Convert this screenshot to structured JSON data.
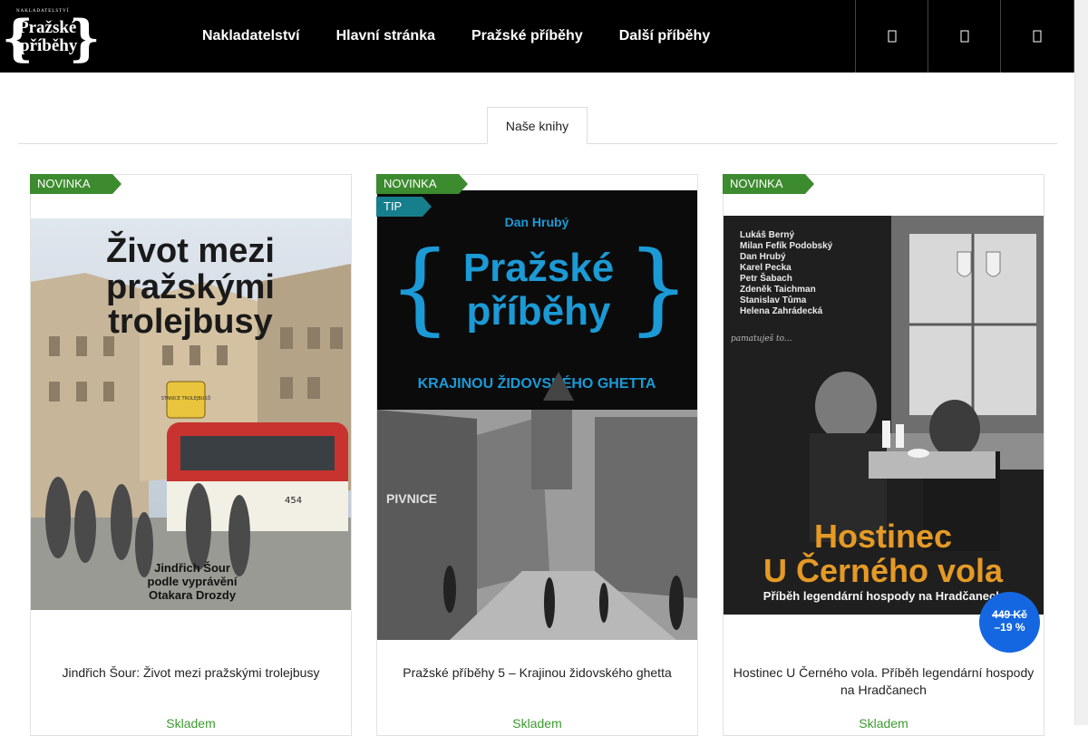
{
  "logo": {
    "small": "NAKLADATELSTVÍ",
    "line1": "Pražské",
    "line2": "příběhy",
    "brace_left": "{",
    "brace_right": "}"
  },
  "nav": [
    {
      "label": "Nakladatelství"
    },
    {
      "label": "Hlavní stránka"
    },
    {
      "label": "Pražské příběhy"
    },
    {
      "label": "Další příběhy"
    }
  ],
  "header_icons": [
    "search-icon",
    "user-icon",
    "cart-icon"
  ],
  "tabs": {
    "active": "Naše knihy"
  },
  "products": [
    {
      "flags": [
        "NOVINKA"
      ],
      "name": "Jindřich Šour: Život mezi pražskými trolejbusy",
      "stock": "Skladem",
      "cover": {
        "title1": "Život mezi",
        "title2": "pražskými",
        "title3": "trolejbusy",
        "bus_number": "454",
        "author1": "Jindřich Šour",
        "author2": "podle vyprávění",
        "author3": "Otakara Drozdy",
        "sign": "STANICE TROLEJBUSŮ"
      }
    },
    {
      "flags": [
        "NOVINKA",
        "TIP"
      ],
      "name": "Pražské příběhy 5 – Krajinou židovského ghetta",
      "stock": "Skladem",
      "cover": {
        "author": "Dan Hrubý",
        "title1": "Pražské",
        "title2": "příběhy",
        "subtitle": "KRAJINOU ŽIDOVSKÉHO GHETTA",
        "sign": "PIVNICE"
      }
    },
    {
      "flags": [
        "NOVINKA"
      ],
      "name": "Hostinec U Černého vola. Příběh legendární hospody na Hradčanech",
      "stock": "Skladem",
      "discount": {
        "old_price": "449 Kč",
        "percent": "–19 %"
      },
      "cover": {
        "authors": [
          "Lukáš Berný",
          "Milan Fefík Podobský",
          "Dan Hrubý",
          "Karel Pecka",
          "Petr Šabach",
          "Zdeněk Taichman",
          "Stanislav Tůma",
          "Helena Zahrádecká"
        ],
        "title1": "Hostinec",
        "title2": "U Černého vola",
        "subtitle": "Příběh legendární hospody na Hradčanech",
        "handwriting": "pamatuješ to..."
      }
    }
  ]
}
